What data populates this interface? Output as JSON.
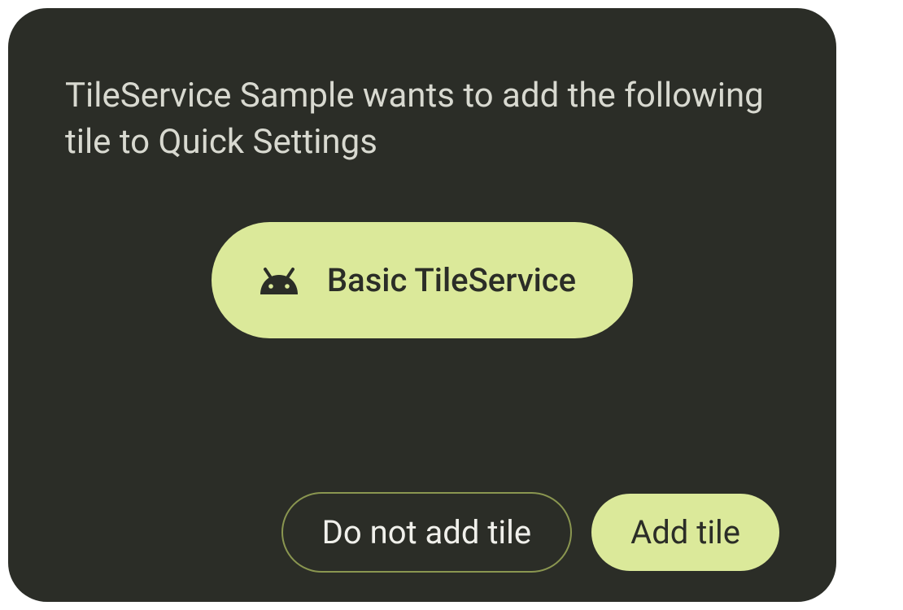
{
  "dialog": {
    "message": "TileService Sample wants to add the following tile to Quick Settings",
    "tile": {
      "icon": "android-icon",
      "label": "Basic TileService"
    },
    "buttons": {
      "deny_label": "Do not add tile",
      "confirm_label": "Add tile"
    }
  },
  "colors": {
    "background": "#2b2d27",
    "accent": "#dbe99a",
    "outline": "#8a9650",
    "text_primary": "#d8d9d0",
    "text_on_accent": "#2b2d27"
  }
}
